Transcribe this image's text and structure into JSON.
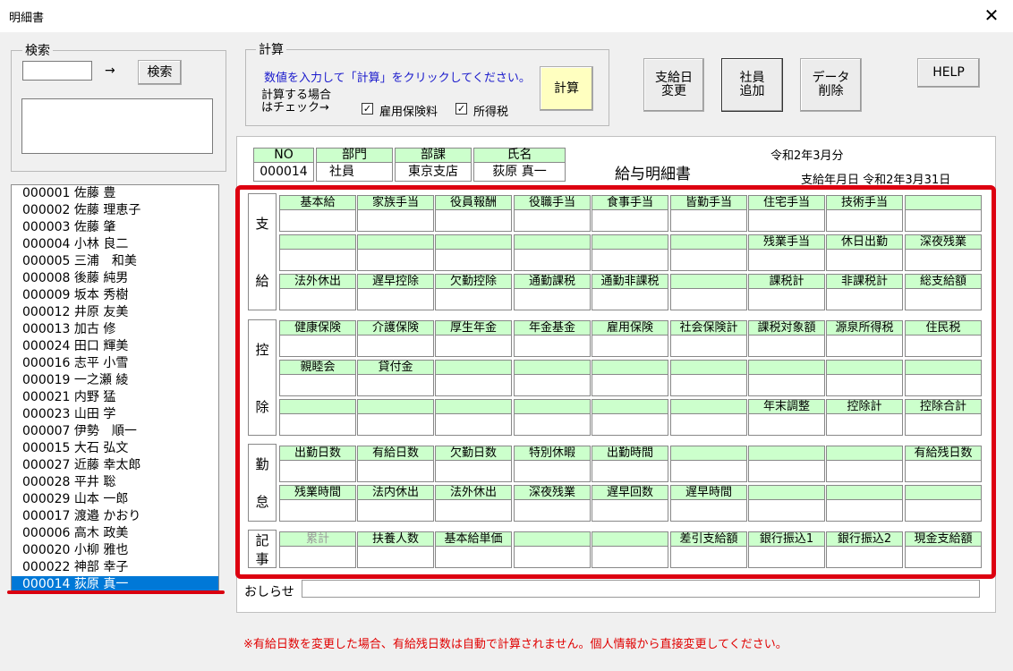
{
  "window": {
    "title": "明細書",
    "close": "✕"
  },
  "search": {
    "legend": "検索",
    "arrow": "→",
    "button": "検索"
  },
  "calc": {
    "legend": "計算",
    "instruction": "数値を入力して「計算」をクリックしてください。",
    "check_note_1": "計算する場合",
    "check_note_2": "はチェック→",
    "cb1_label": "雇用保険料",
    "cb1_checked": true,
    "cb2_label": "所得税",
    "cb2_checked": true,
    "button": "計算"
  },
  "toolbar": {
    "change_payday": "支給日\n変更",
    "add_employee": "社員\n追加",
    "delete_data": "データ\n削除",
    "help": "HELP"
  },
  "employees": [
    "000001 佐藤 豊",
    "000002 佐藤 理恵子",
    "000003 佐藤 肇",
    "000004 小林 良二",
    "000005 三浦　和美",
    "000008 後藤 純男",
    "000009 坂本 秀樹",
    "000012 井原 友美",
    "000013 加古 修",
    "000024 田口 輝美",
    "000016 志平 小雪",
    "000019 一之瀬 綾",
    "000021 内野 猛",
    "000023 山田 学",
    "000007 伊勢　順一",
    "000015 大石 弘文",
    "000027 近藤 幸太郎",
    "000028 平井 聡",
    "000029 山本 一郎",
    "000017 渡邉 かおり",
    "000006 高木 政美",
    "000020 小柳 雅也",
    "000022 神部 幸子",
    "000014 荻原 真一"
  ],
  "selected_index": 23,
  "slip": {
    "header": {
      "no_label": "NO",
      "no_value": "000014",
      "dept_label": "部門",
      "dept_value": "社員",
      "section_label": "部課",
      "section_value": "東京支店",
      "name_label": "氏名",
      "name_value": "荻原 真一"
    },
    "month": "令和2年3月分",
    "title": "給与明細書",
    "pay_date": "支給年月日 令和2年3月31日"
  },
  "sections": {
    "payment": {
      "label": [
        "支",
        "給"
      ],
      "rows": [
        [
          "基本給",
          "家族手当",
          "役員報酬",
          "役職手当",
          "食事手当",
          "皆勤手当",
          "住宅手当",
          "技術手当",
          ""
        ],
        [
          "",
          "",
          "",
          "",
          "",
          "",
          "残業手当",
          "休日出勤",
          "深夜残業"
        ],
        [
          "法外休出",
          "遅早控除",
          "欠勤控除",
          "通勤課税",
          "通勤非課税",
          "",
          "課税計",
          "非課税計",
          "総支給額"
        ]
      ]
    },
    "deduction": {
      "label": [
        "控",
        "除"
      ],
      "rows": [
        [
          "健康保険",
          "介護保険",
          "厚生年金",
          "年金基金",
          "雇用保険",
          "社会保険計",
          "課税対象額",
          "源泉所得税",
          "住民税"
        ],
        [
          "親睦会",
          "貸付金",
          "",
          "",
          "",
          "",
          "",
          "",
          ""
        ],
        [
          "",
          "",
          "",
          "",
          "",
          "",
          "年末調整",
          "控除計",
          "控除合計"
        ]
      ]
    },
    "attendance": {
      "label": [
        "勤",
        "怠"
      ],
      "rows": [
        [
          "出勤日数",
          "有給日数",
          "欠勤日数",
          "特別休暇",
          "出勤時間",
          "",
          "",
          "",
          "有給残日数"
        ],
        [
          "残業時間",
          "法内休出",
          "法外休出",
          "深夜残業",
          "遅早回数",
          "遅早時間",
          "",
          "",
          ""
        ]
      ]
    },
    "notes": {
      "label": [
        "記",
        "事"
      ],
      "rows": [
        [
          "累計",
          "扶養人数",
          "基本給単価",
          "",
          "",
          "差引支給額",
          "銀行振込1",
          "銀行振込2",
          "現金支給額"
        ]
      ]
    }
  },
  "notice_label": "おしらせ",
  "warning": "※有給日数を変更した場合、有給残日数は自動で計算されません。個人情報から直接変更してください。",
  "colors": {
    "label_bg": "#ccffcc",
    "highlight": "#dd0010",
    "selection": "#0078d7",
    "calc_button": "#ffffc0"
  }
}
